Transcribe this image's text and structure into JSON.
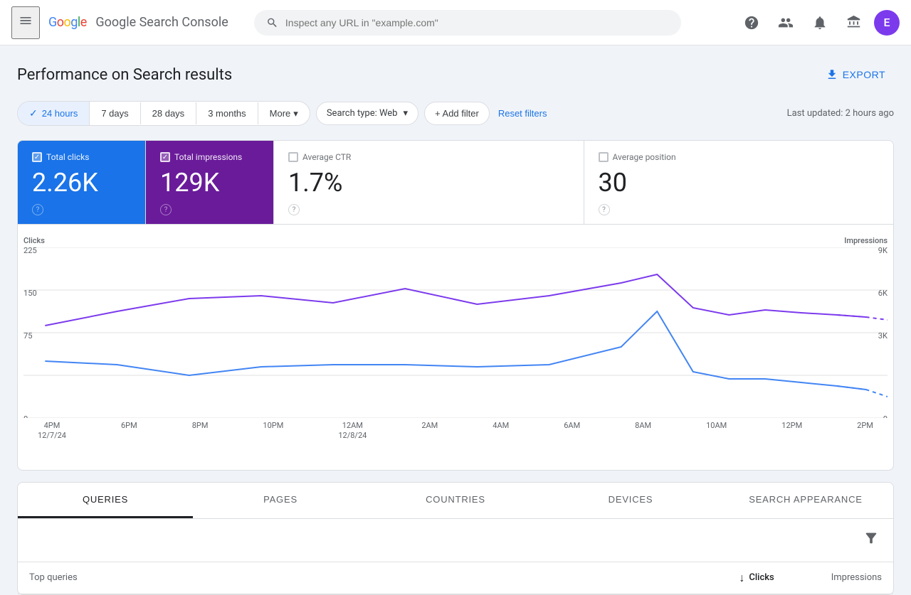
{
  "header": {
    "menu_icon": "☰",
    "logo_text": "Google Search Console",
    "search_placeholder": "Inspect any URL in \"example.com\"",
    "avatar_initial": "E",
    "help_icon": "?",
    "user_icon": "👤",
    "bell_icon": "🔔",
    "grid_icon": "⊞"
  },
  "page": {
    "title": "Performance on Search results",
    "export_label": "EXPORT",
    "last_updated": "Last updated: 2 hours ago"
  },
  "filters": {
    "date_tabs": [
      {
        "label": "24 hours",
        "active": true
      },
      {
        "label": "7 days",
        "active": false
      },
      {
        "label": "28 days",
        "active": false
      },
      {
        "label": "3 months",
        "active": false
      },
      {
        "label": "More",
        "active": false,
        "has_arrow": true
      }
    ],
    "search_type": "Search type: Web",
    "add_filter": "+ Add filter",
    "reset_filters": "Reset filters"
  },
  "stats": [
    {
      "id": "clicks",
      "label": "Total clicks",
      "value": "2.26K",
      "checked": true,
      "type": "clicks"
    },
    {
      "id": "impressions",
      "label": "Total impressions",
      "value": "129K",
      "checked": true,
      "type": "impressions"
    },
    {
      "id": "ctr",
      "label": "Average CTR",
      "value": "1.7%",
      "checked": false,
      "type": "ctr"
    },
    {
      "id": "position",
      "label": "Average position",
      "value": "30",
      "checked": false,
      "type": "position"
    }
  ],
  "chart": {
    "y_left_title": "Clicks",
    "y_right_title": "Impressions",
    "y_left_labels": [
      "225",
      "150",
      "75",
      "0"
    ],
    "y_right_labels": [
      "9K",
      "6K",
      "3K",
      "0"
    ],
    "x_labels": [
      {
        "line1": "4PM",
        "line2": "12/7/24"
      },
      {
        "line1": "6PM",
        "line2": ""
      },
      {
        "line1": "8PM",
        "line2": ""
      },
      {
        "line1": "10PM",
        "line2": ""
      },
      {
        "line1": "12AM",
        "line2": "12/8/24"
      },
      {
        "line1": "2AM",
        "line2": ""
      },
      {
        "line1": "4AM",
        "line2": ""
      },
      {
        "line1": "6AM",
        "line2": ""
      },
      {
        "line1": "8AM",
        "line2": ""
      },
      {
        "line1": "10AM",
        "line2": ""
      },
      {
        "line1": "12PM",
        "line2": ""
      },
      {
        "line1": "2PM",
        "line2": ""
      }
    ]
  },
  "bottom_tabs": [
    {
      "label": "QUERIES",
      "active": true
    },
    {
      "label": "PAGES",
      "active": false
    },
    {
      "label": "COUNTRIES",
      "active": false
    },
    {
      "label": "DEVICES",
      "active": false
    },
    {
      "label": "SEARCH APPEARANCE",
      "active": false
    }
  ],
  "table": {
    "header_label": "Top queries",
    "clicks_label": "Clicks",
    "impressions_label": "Impressions"
  }
}
